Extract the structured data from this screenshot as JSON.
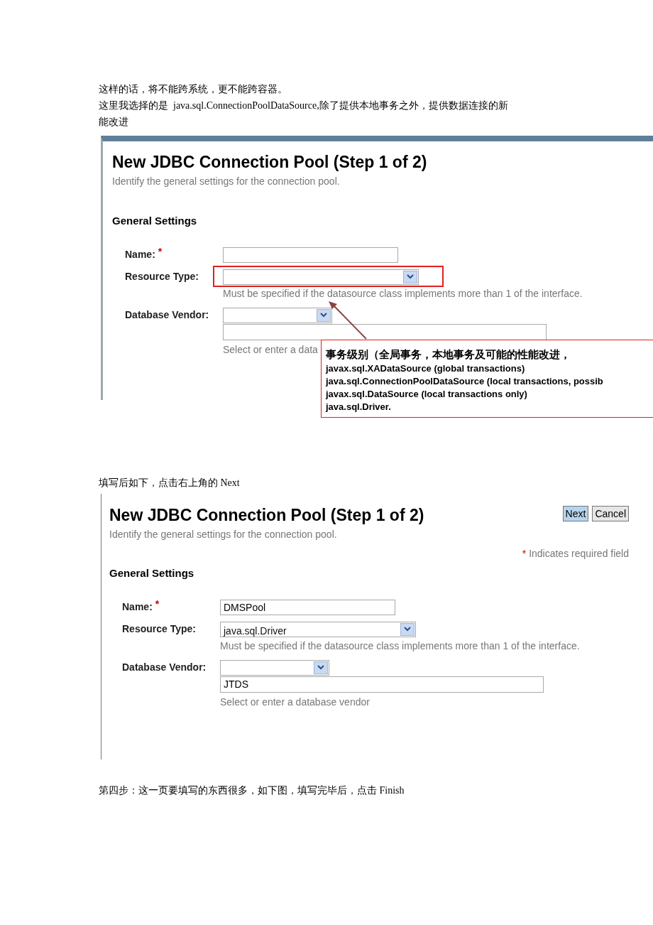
{
  "paragraphs_top": [
    "这样的话，将不能跨系统，更不能跨容器。",
    "这里我选择的是  java.sql.ConnectionPoolDataSource,除了提供本地事务之外，提供数据连接的新",
    "能改进"
  ],
  "screenshot_1": {
    "title": "New JDBC Connection Pool (Step 1 of 2)",
    "subtitle": "Identify the general settings for the connection pool.",
    "section": "General Settings",
    "name": {
      "label": "Name:",
      "required_mark": "*"
    },
    "resource_type": {
      "label": "Resource Type:",
      "hint": "Must be specified if the datasource class implements more than 1 of the interface."
    },
    "database_vendor": {
      "label": "Database Vendor:",
      "hint": "Select or enter a data"
    },
    "callout": {
      "lines": [
        "事务级别（全局事务，本地事务及可能的性能改进，",
        "javax.sql.XADataSource (global transactions)",
        "java.sql.ConnectionPoolDataSource (local transactions, possib",
        "javax.sql.DataSource (local transactions only)",
        "java.sql.Driver."
      ]
    }
  },
  "paragraph_middle": "填写后如下，点击右上角的 Next",
  "screenshot_2": {
    "title": "New JDBC Connection Pool (Step 1 of 2)",
    "subtitle": "Identify the general settings for the connection pool.",
    "buttons": [
      "Next",
      "Cancel"
    ],
    "required_note": {
      "mark": "*",
      "text": "Indicates required field"
    },
    "section": "General Settings",
    "name": {
      "label": "Name:",
      "required_mark": "*",
      "value": "DMSPool"
    },
    "resource_type": {
      "label": "Resource Type:",
      "value": "java.sql.Driver",
      "hint": "Must be specified if the datasource class implements more than 1 of the interface."
    },
    "database_vendor": {
      "label": "Database Vendor:",
      "input_value": "JTDS",
      "hint": "Select or enter a database vendor"
    }
  },
  "paragraph_bottom": "第四步：这一页要填写的东西很多，如下图，填写完毕后，点击 Finish"
}
